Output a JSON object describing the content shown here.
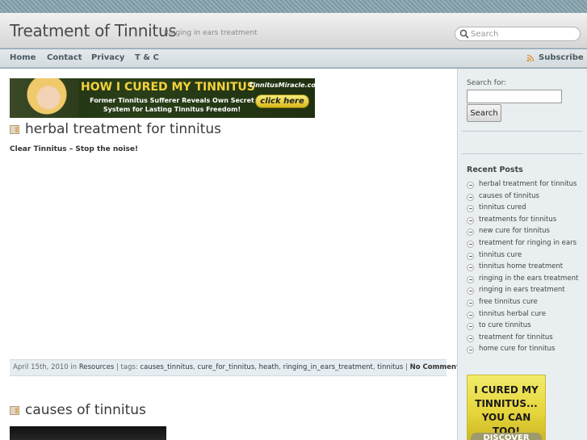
{
  "header": {
    "site_title": "Treatment of Tinnitus",
    "tagline": "Ringing in ears treatment",
    "search_placeholder": "Search"
  },
  "nav": {
    "items": [
      "Home",
      "Contact",
      "Privacy",
      "T & C"
    ],
    "subscribe": "Subscribe"
  },
  "banner": {
    "headline": "HOW I CURED MY TINNITUS",
    "brand": "TinnitusMiracle.com",
    "subtext": "Former Tinnitus Sufferer Reveals Own Secret System for Lasting Tinnitus Freedom!",
    "button": "click here"
  },
  "posts": [
    {
      "title": "herbal treatment for tinnitus",
      "excerpt": "Clear Tinnitus – Stop the noise!",
      "date": "April 15th, 2010",
      "in_label": "in",
      "category": "Resources",
      "tags_label": "| tags:",
      "tags": [
        "causes_tinnitus",
        "cure_for_tinnitus",
        "heath",
        "ringing_in_ears_treatment",
        "tinnitus"
      ],
      "comments": "No Comments"
    },
    {
      "title": "causes of tinnitus"
    }
  ],
  "sidebar": {
    "search_label": "Search for:",
    "search_button": "Search",
    "recent_title": "Recent Posts",
    "recent_posts": [
      "herbal treatment for tinnitus",
      "causes of tinnitus",
      "tinnitus cured",
      "treatments for tinnitus",
      "new cure for tinnitus",
      "treatment for ringing in ears",
      "tinnitus cure",
      "tinnitus home treatment",
      "ringing in the ears treatment",
      "ringing in ears treatment",
      "free tinnitus cure",
      "tinnitus herbal cure",
      "to cure tinnitus",
      "treatment for tinnitus",
      "home cure for tinnitus"
    ],
    "ad": {
      "line1": "I CURED MY",
      "line2": "TINNITUS...",
      "line3": "YOU CAN TOO!",
      "button": "DISCOVER"
    }
  },
  "colors": {
    "header_title": "#4a4a4a",
    "nav_text": "#4b5a61",
    "sidebar_bg": "#e9eef0",
    "banner_accent": "#f5d23a"
  }
}
